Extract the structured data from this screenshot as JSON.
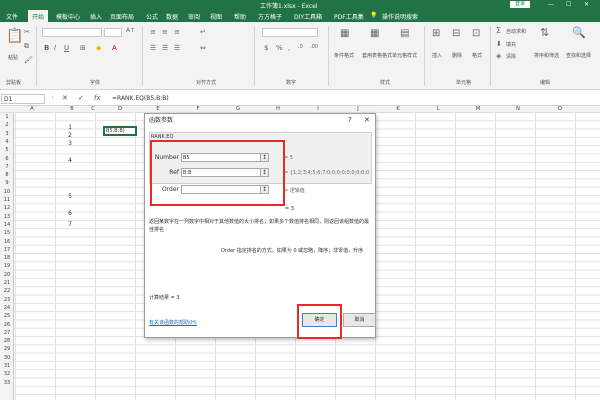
{
  "window": {
    "title": "工作簿1.xlsx - Excel",
    "login_label": "登录"
  },
  "ribbon_tabs": [
    "文件",
    "开始",
    "模板中心",
    "插入",
    "页面布局",
    "公式",
    "数据",
    "审阅",
    "视图",
    "帮助",
    "方方格子",
    "DIY工具箱",
    "PDF工具集"
  ],
  "ribbon": {
    "tell_me": "操作说明搜索",
    "groups": [
      "剪贴板",
      "字体",
      "对齐方式",
      "数字",
      "样式",
      "单元格",
      "编辑"
    ],
    "autosum_label": "自动求和",
    "paste_label": "粘贴",
    "cond_format_label": "条件格式",
    "format_table_label": "套用表格格式",
    "cell_styles_label": "单元格样式",
    "insert_label": "插入",
    "delete_label": "删除",
    "format_label": "格式",
    "sort_label": "排序和筛选",
    "find_label": "查找和选择",
    "clear_label": "清除",
    "fill_label": "填充"
  },
  "formula_bar": {
    "name_box": "D1",
    "fx": "fx",
    "formula": "=RANK.EQ(B5,B:B)"
  },
  "columns": [
    "A",
    "B",
    "C",
    "D",
    "E",
    "F",
    "G",
    "H",
    "I",
    "J",
    "K",
    "L",
    "M",
    "N",
    "O"
  ],
  "rows": [
    "1",
    "2",
    "3",
    "4",
    "5",
    "6",
    "7",
    "8",
    "9",
    "10",
    "11",
    "12",
    "13",
    "14",
    "15",
    "16",
    "17",
    "18",
    "19",
    "20",
    "21",
    "22",
    "23",
    "24",
    "25",
    "26",
    "27",
    "28",
    "29",
    "30",
    "31",
    "32",
    "33"
  ],
  "cells_b": [
    "1",
    "2",
    "3",
    "4",
    "5",
    "6",
    "7"
  ],
  "active_cell_text": "B5,B:B)",
  "dialog": {
    "title": "函数参数",
    "function_name": "RANK.EQ",
    "args": [
      {
        "label": "Number",
        "value": "B5",
        "result": "= 5"
      },
      {
        "label": "Ref",
        "value": "B:B",
        "result": "= {1;2;3;4;5;6;7;0;0;0;0;0;0;0;0;0;0;0;0;0;0;0;0;0"
      },
      {
        "label": "Order",
        "value": "",
        "result": "= 逻辑值"
      }
    ],
    "eq3": "= 3",
    "description": "返回某数字在一列数字中相对于其他数值的大小排名；如果多个数值排名相同，则返回该组数值的最佳排名",
    "order_desc": "Order  指定排名的方式。如果为 0 或忽略，降序；非零值，升序",
    "result_label": "计算结果 =  3",
    "help_link": "有关该函数的帮助(H)",
    "ok_label": "确定",
    "cancel_label": "取消"
  },
  "colors": {
    "excel_green": "#217346",
    "highlight_red": "#e62a2a"
  }
}
